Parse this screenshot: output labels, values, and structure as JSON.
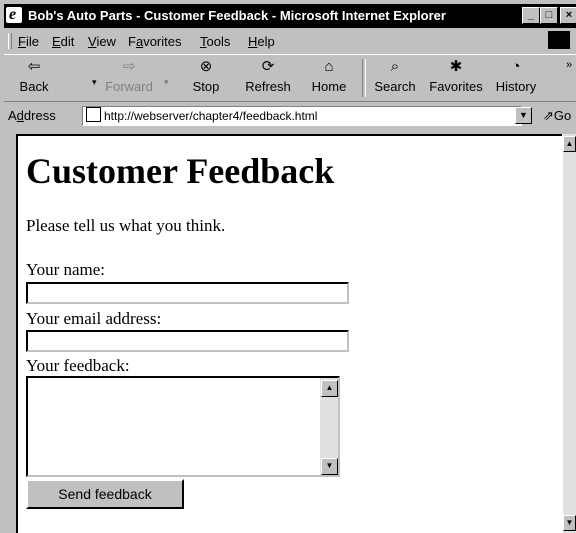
{
  "window": {
    "title": "Bob's Auto Parts - Customer Feedback - Microsoft Internet Explorer",
    "app_icon_glyph": "e",
    "minimize_glyph": "_",
    "maximize_glyph": "□",
    "close_glyph": "×"
  },
  "menu": [
    {
      "access": "F",
      "rest": "ile"
    },
    {
      "access": "E",
      "rest": "dit"
    },
    {
      "access": "V",
      "rest": "iew"
    },
    {
      "pre": "F",
      "access": "a",
      "rest": "vorites"
    },
    {
      "access": "T",
      "rest": "ools"
    },
    {
      "access": "H",
      "rest": "elp"
    }
  ],
  "toolbar": {
    "back": {
      "label": "Back",
      "icon": "back-arrow-icon",
      "glyph": "⇦",
      "enabled": true
    },
    "forward": {
      "label": "Forward",
      "icon": "forward-arrow-icon",
      "glyph": "⇨",
      "enabled": false
    },
    "stop": {
      "label": "Stop",
      "icon": "stop-icon",
      "glyph": "⊗"
    },
    "refresh": {
      "label": "Refresh",
      "icon": "refresh-icon",
      "glyph": "⟳"
    },
    "home": {
      "label": "Home",
      "icon": "home-icon",
      "glyph": "⌂"
    },
    "search": {
      "label": "Search",
      "icon": "search-icon",
      "glyph": "⌕"
    },
    "favorites": {
      "label": "Favorites",
      "icon": "favorites-icon",
      "glyph": "✱"
    },
    "history": {
      "label": "History",
      "icon": "history-icon",
      "glyph": "◔"
    },
    "overflow_glyph": "»",
    "dropdown_glyph": "▾"
  },
  "address": {
    "label_pre": "A",
    "label_access": "d",
    "label_rest": "dress",
    "url": "http://webserver/chapter4/feedback.html",
    "dropdown_glyph": "▼",
    "go_label": "Go",
    "go_glyph": "⇗"
  },
  "page": {
    "heading": "Customer Feedback",
    "intro": "Please tell us what you think.",
    "name_label": "Your name:",
    "name_value": "",
    "email_label": "Your email address:",
    "email_value": "",
    "feedback_label": "Your feedback:",
    "feedback_value": "",
    "submit_label": "Send feedback"
  },
  "scroll_glyphs": {
    "up": "▲",
    "down": "▼"
  }
}
